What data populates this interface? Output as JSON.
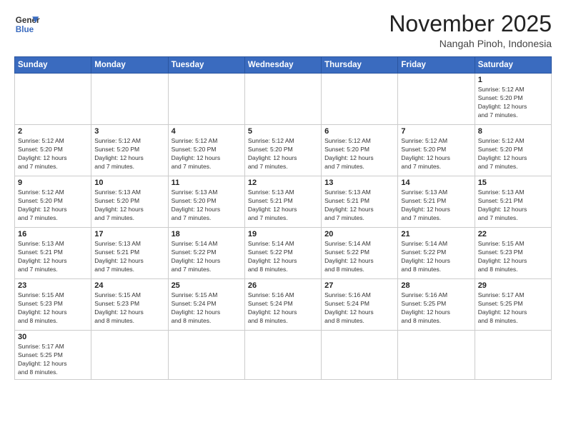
{
  "logo": {
    "line1": "General",
    "line2": "Blue"
  },
  "title": "November 2025",
  "subtitle": "Nangah Pinoh, Indonesia",
  "days_of_week": [
    "Sunday",
    "Monday",
    "Tuesday",
    "Wednesday",
    "Thursday",
    "Friday",
    "Saturday"
  ],
  "weeks": [
    [
      {
        "day": "",
        "info": ""
      },
      {
        "day": "",
        "info": ""
      },
      {
        "day": "",
        "info": ""
      },
      {
        "day": "",
        "info": ""
      },
      {
        "day": "",
        "info": ""
      },
      {
        "day": "",
        "info": ""
      },
      {
        "day": "1",
        "info": "Sunrise: 5:12 AM\nSunset: 5:20 PM\nDaylight: 12 hours\nand 7 minutes."
      }
    ],
    [
      {
        "day": "2",
        "info": "Sunrise: 5:12 AM\nSunset: 5:20 PM\nDaylight: 12 hours\nand 7 minutes."
      },
      {
        "day": "3",
        "info": "Sunrise: 5:12 AM\nSunset: 5:20 PM\nDaylight: 12 hours\nand 7 minutes."
      },
      {
        "day": "4",
        "info": "Sunrise: 5:12 AM\nSunset: 5:20 PM\nDaylight: 12 hours\nand 7 minutes."
      },
      {
        "day": "5",
        "info": "Sunrise: 5:12 AM\nSunset: 5:20 PM\nDaylight: 12 hours\nand 7 minutes."
      },
      {
        "day": "6",
        "info": "Sunrise: 5:12 AM\nSunset: 5:20 PM\nDaylight: 12 hours\nand 7 minutes."
      },
      {
        "day": "7",
        "info": "Sunrise: 5:12 AM\nSunset: 5:20 PM\nDaylight: 12 hours\nand 7 minutes."
      },
      {
        "day": "8",
        "info": "Sunrise: 5:12 AM\nSunset: 5:20 PM\nDaylight: 12 hours\nand 7 minutes."
      }
    ],
    [
      {
        "day": "9",
        "info": "Sunrise: 5:12 AM\nSunset: 5:20 PM\nDaylight: 12 hours\nand 7 minutes."
      },
      {
        "day": "10",
        "info": "Sunrise: 5:13 AM\nSunset: 5:20 PM\nDaylight: 12 hours\nand 7 minutes."
      },
      {
        "day": "11",
        "info": "Sunrise: 5:13 AM\nSunset: 5:20 PM\nDaylight: 12 hours\nand 7 minutes."
      },
      {
        "day": "12",
        "info": "Sunrise: 5:13 AM\nSunset: 5:21 PM\nDaylight: 12 hours\nand 7 minutes."
      },
      {
        "day": "13",
        "info": "Sunrise: 5:13 AM\nSunset: 5:21 PM\nDaylight: 12 hours\nand 7 minutes."
      },
      {
        "day": "14",
        "info": "Sunrise: 5:13 AM\nSunset: 5:21 PM\nDaylight: 12 hours\nand 7 minutes."
      },
      {
        "day": "15",
        "info": "Sunrise: 5:13 AM\nSunset: 5:21 PM\nDaylight: 12 hours\nand 7 minutes."
      }
    ],
    [
      {
        "day": "16",
        "info": "Sunrise: 5:13 AM\nSunset: 5:21 PM\nDaylight: 12 hours\nand 7 minutes."
      },
      {
        "day": "17",
        "info": "Sunrise: 5:13 AM\nSunset: 5:21 PM\nDaylight: 12 hours\nand 7 minutes."
      },
      {
        "day": "18",
        "info": "Sunrise: 5:14 AM\nSunset: 5:22 PM\nDaylight: 12 hours\nand 7 minutes."
      },
      {
        "day": "19",
        "info": "Sunrise: 5:14 AM\nSunset: 5:22 PM\nDaylight: 12 hours\nand 8 minutes."
      },
      {
        "day": "20",
        "info": "Sunrise: 5:14 AM\nSunset: 5:22 PM\nDaylight: 12 hours\nand 8 minutes."
      },
      {
        "day": "21",
        "info": "Sunrise: 5:14 AM\nSunset: 5:22 PM\nDaylight: 12 hours\nand 8 minutes."
      },
      {
        "day": "22",
        "info": "Sunrise: 5:15 AM\nSunset: 5:23 PM\nDaylight: 12 hours\nand 8 minutes."
      }
    ],
    [
      {
        "day": "23",
        "info": "Sunrise: 5:15 AM\nSunset: 5:23 PM\nDaylight: 12 hours\nand 8 minutes."
      },
      {
        "day": "24",
        "info": "Sunrise: 5:15 AM\nSunset: 5:23 PM\nDaylight: 12 hours\nand 8 minutes."
      },
      {
        "day": "25",
        "info": "Sunrise: 5:15 AM\nSunset: 5:24 PM\nDaylight: 12 hours\nand 8 minutes."
      },
      {
        "day": "26",
        "info": "Sunrise: 5:16 AM\nSunset: 5:24 PM\nDaylight: 12 hours\nand 8 minutes."
      },
      {
        "day": "27",
        "info": "Sunrise: 5:16 AM\nSunset: 5:24 PM\nDaylight: 12 hours\nand 8 minutes."
      },
      {
        "day": "28",
        "info": "Sunrise: 5:16 AM\nSunset: 5:25 PM\nDaylight: 12 hours\nand 8 minutes."
      },
      {
        "day": "29",
        "info": "Sunrise: 5:17 AM\nSunset: 5:25 PM\nDaylight: 12 hours\nand 8 minutes."
      }
    ],
    [
      {
        "day": "30",
        "info": "Sunrise: 5:17 AM\nSunset: 5:25 PM\nDaylight: 12 hours\nand 8 minutes."
      },
      {
        "day": "",
        "info": ""
      },
      {
        "day": "",
        "info": ""
      },
      {
        "day": "",
        "info": ""
      },
      {
        "day": "",
        "info": ""
      },
      {
        "day": "",
        "info": ""
      },
      {
        "day": "",
        "info": ""
      }
    ]
  ]
}
